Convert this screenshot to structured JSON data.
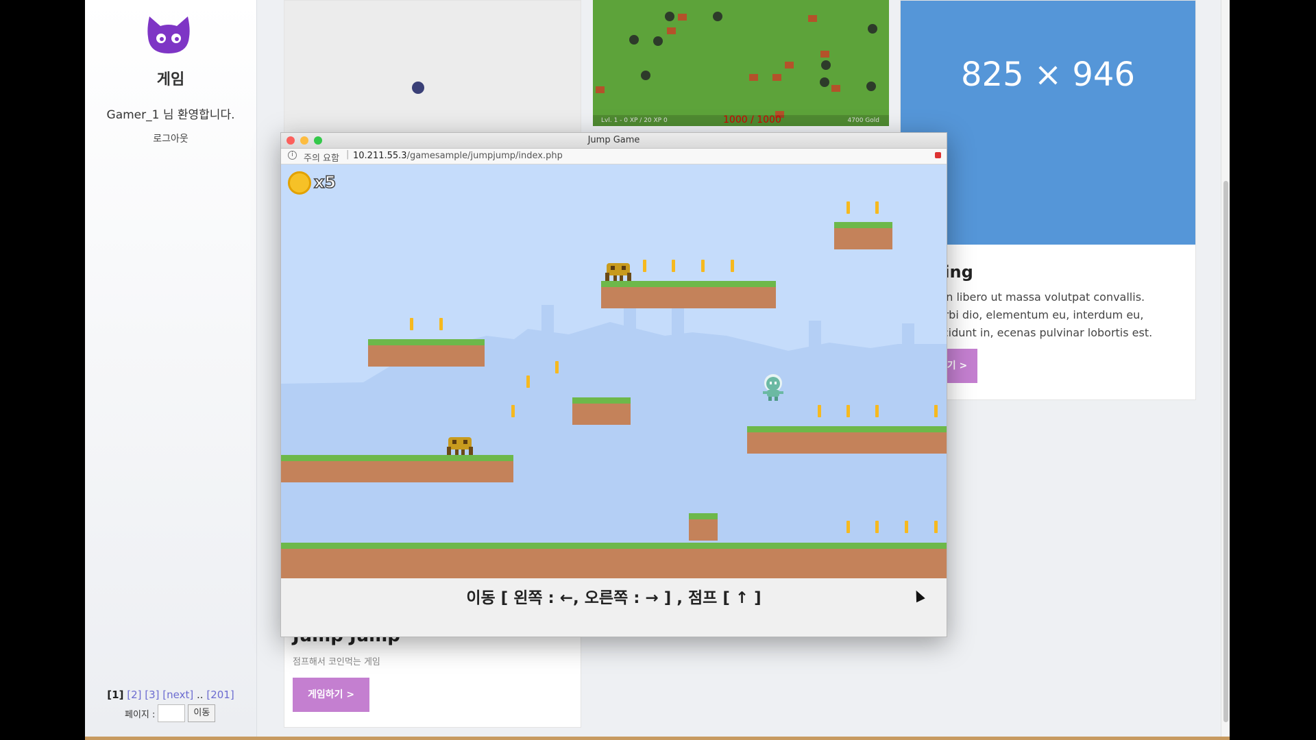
{
  "sidebar": {
    "title": "게임",
    "welcome": "Gamer_1 님 환영합니다.",
    "logout": "로그아웃",
    "pager": {
      "current": "[1]",
      "p2": "[2]",
      "p3": "[3]",
      "next": "[next]",
      "ellipsis": "..",
      "last": "[201]"
    },
    "page_label": "페이지 :",
    "go_button": "이동"
  },
  "cards": {
    "jump": {
      "title": "Jump Jump",
      "desc": "점프해서 코인먹는 게임",
      "button": "게임하기 >"
    },
    "rpg": {
      "hud_left": "Lvl. 1 - 0 XP / 20 XP    0",
      "hud_mid": "1000 / 1000",
      "hud_right": "4700 Gold"
    },
    "third": {
      "placeholder": "825 × 946",
      "title": "tring",
      "text": "ur in libero ut massa volutpat convallis. Morbi dio, elementum eu, interdum eu, tincidunt in, ecenas pulvinar lobortis est.",
      "button": "하기 >"
    }
  },
  "popup": {
    "title": "Jump Game",
    "warning": "주의 요함",
    "url_host": "10.211.55.3",
    "url_path": "/gamesample/jumpjump/index.php",
    "coin_count": "x5",
    "controls": "이동 [ 왼쪽 : ←, 오른쪽 : → ] , 점프 [ ↑ ]"
  },
  "colors": {
    "accent": "#c47fd0",
    "placeholder_bg": "#5596d8",
    "sky": "#c5dcfb",
    "grass": "#6db84a",
    "dirt": "#c4825a",
    "coin": "#f6b91f"
  }
}
